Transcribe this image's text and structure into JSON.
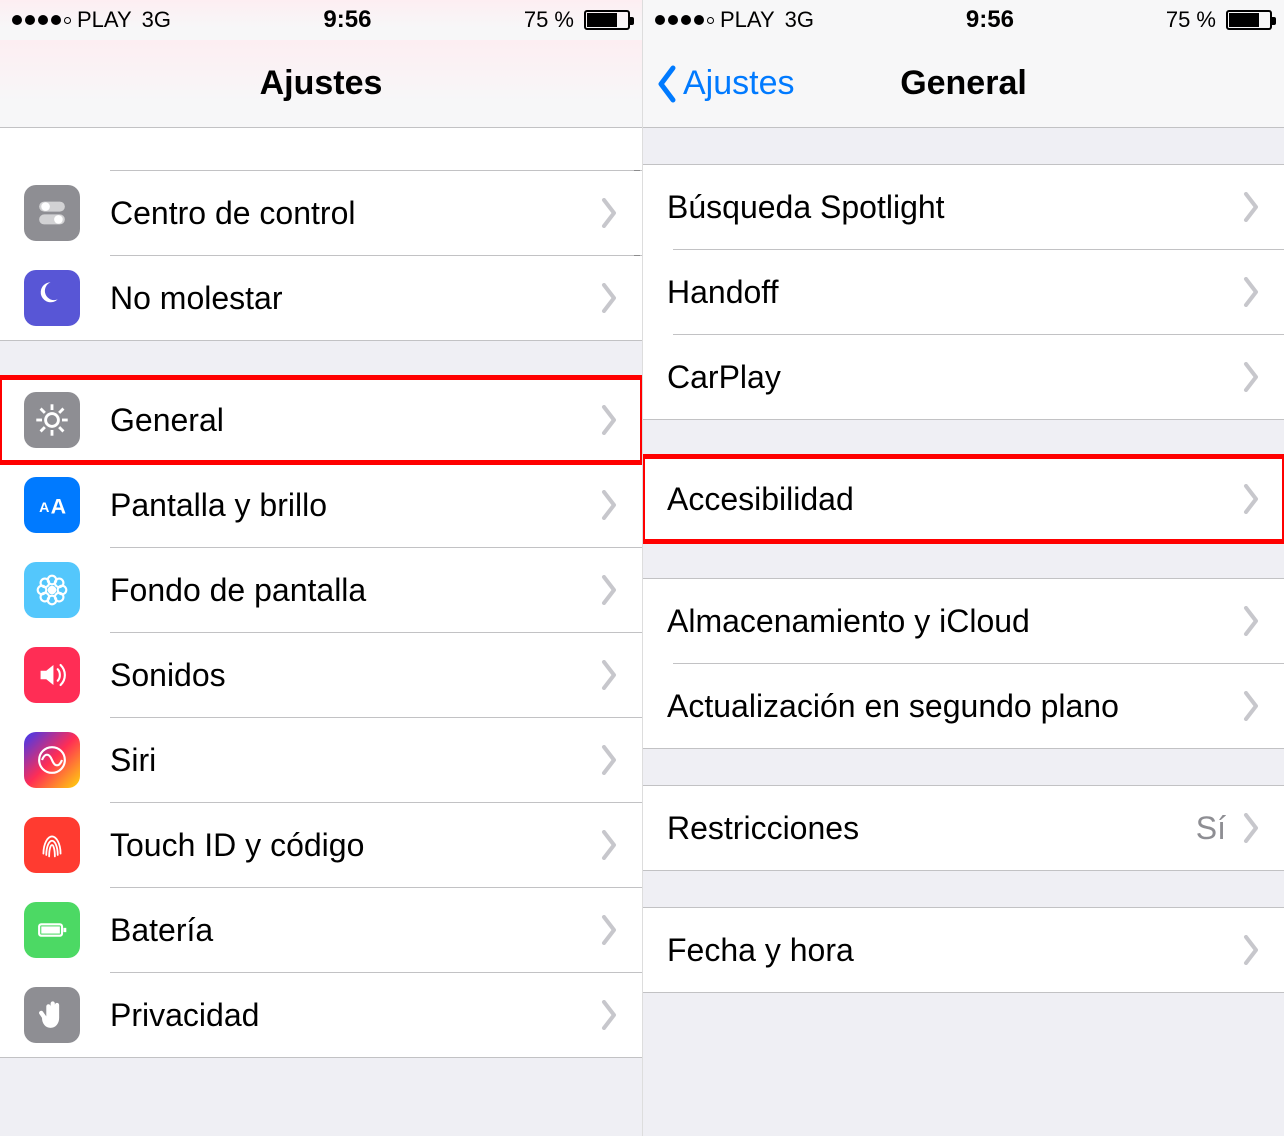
{
  "status": {
    "carrier": "PLAY",
    "network": "3G",
    "time": "9:56",
    "battery": "75 %"
  },
  "left": {
    "title": "Ajustes",
    "groups": [
      {
        "rows": [
          {
            "id": "control-center",
            "label": "Centro de control",
            "icon": "toggles",
            "bg": "bg-gray"
          },
          {
            "id": "dnd",
            "label": "No molestar",
            "icon": "moon",
            "bg": "bg-indigo"
          }
        ]
      },
      {
        "rows": [
          {
            "id": "general",
            "label": "General",
            "icon": "gear",
            "bg": "bg-gray",
            "highlight": true
          },
          {
            "id": "display",
            "label": "Pantalla y brillo",
            "icon": "aa",
            "bg": "bg-blue"
          },
          {
            "id": "wallpaper",
            "label": "Fondo de pantalla",
            "icon": "flower",
            "bg": "bg-cyan"
          },
          {
            "id": "sounds",
            "label": "Sonidos",
            "icon": "speaker",
            "bg": "bg-pink"
          },
          {
            "id": "siri",
            "label": "Siri",
            "icon": "siri",
            "bg": "bg-siri"
          },
          {
            "id": "touchid",
            "label": "Touch ID y código",
            "icon": "fingerprint",
            "bg": "bg-red"
          },
          {
            "id": "battery",
            "label": "Batería",
            "icon": "battery",
            "bg": "bg-green"
          },
          {
            "id": "privacy",
            "label": "Privacidad",
            "icon": "hand",
            "bg": "bg-gray"
          }
        ]
      }
    ]
  },
  "right": {
    "title": "General",
    "back": "Ajustes",
    "groups": [
      {
        "rows": [
          {
            "id": "spotlight",
            "label": "Búsqueda Spotlight"
          },
          {
            "id": "handoff",
            "label": "Handoff"
          },
          {
            "id": "carplay",
            "label": "CarPlay"
          }
        ]
      },
      {
        "rows": [
          {
            "id": "accessibility",
            "label": "Accesibilidad",
            "highlight": true
          }
        ]
      },
      {
        "rows": [
          {
            "id": "storage",
            "label": "Almacenamiento y iCloud"
          },
          {
            "id": "bg-refresh",
            "label": "Actualización en segundo plano"
          }
        ]
      },
      {
        "rows": [
          {
            "id": "restrictions",
            "label": "Restricciones",
            "detail": "Sí"
          }
        ]
      },
      {
        "rows": [
          {
            "id": "datetime",
            "label": "Fecha y hora"
          }
        ]
      }
    ]
  }
}
